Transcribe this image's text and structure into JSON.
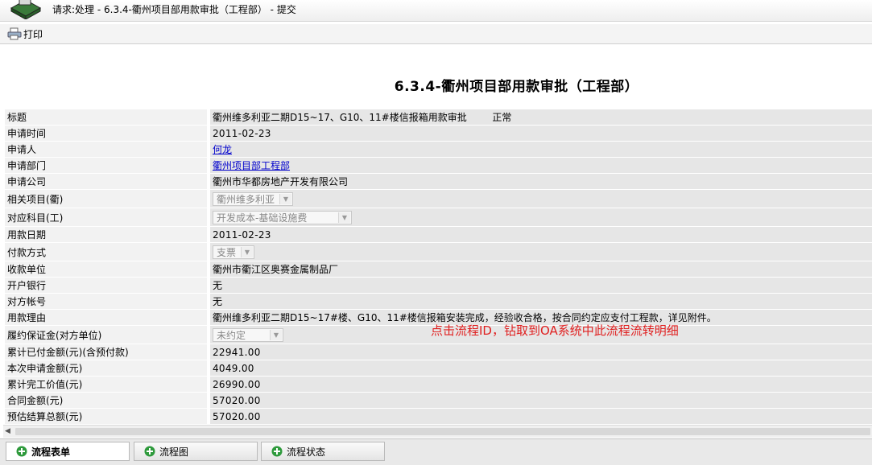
{
  "window": {
    "title": "请求:处理  - 6.3.4-衢州项目部用款审批（工程部） - 提交"
  },
  "toolbar": {
    "print_label": "打印",
    "print_icon": "printer-icon"
  },
  "form": {
    "title": "6.3.4-衢州项目部用款审批（工程部）",
    "rows": {
      "subject": {
        "label": "标题",
        "value": "衢州维多利亚二期D15~17、G10、11#楼信报箱用款审批",
        "priority": "正常"
      },
      "apply_date": {
        "label": "申请时间",
        "value": "2011-02-23"
      },
      "applicant": {
        "label": "申请人",
        "value": "何龙"
      },
      "department": {
        "label": "申请部门",
        "value": "衢州项目部工程部"
      },
      "company": {
        "label": "申请公司",
        "value": "衢州市华都房地产开发有限公司"
      },
      "project": {
        "label": "相关项目(衢)",
        "value": "衢州维多利亚"
      },
      "account": {
        "label": "对应科目(工)",
        "value": "开发成本-基础设施费"
      },
      "use_date": {
        "label": "用款日期",
        "value": "2011-02-23"
      },
      "payment_method": {
        "label": "付款方式",
        "value": "支票"
      },
      "payee": {
        "label": "收款单位",
        "value": "衢州市衢江区奥赛金属制品厂"
      },
      "bank": {
        "label": "开户银行",
        "value": "无"
      },
      "account_no": {
        "label": "对方帐号",
        "value": "无"
      },
      "reason": {
        "label": "用款理由",
        "value": "衢州维多利亚二期D15~17#楼、G10、11#楼信报箱安装完成，经验收合格，按合同约定应支付工程款，详见附件。"
      },
      "deposit": {
        "label": "履约保证金(对方单位)",
        "value": "未约定"
      },
      "paid_total": {
        "label": "累计已付金额(元)(含预付款)",
        "value": "22941.00"
      },
      "current_amount": {
        "label": "本次申请金额(元)",
        "value": "4049.00"
      },
      "completed_value": {
        "label": "累计完工价值(元)",
        "value": "26990.00"
      },
      "contract_amount": {
        "label": "合同金额(元)",
        "value": "57020.00"
      },
      "estimated_total": {
        "label": "预估结算总额(元)",
        "value": "57020.00"
      }
    }
  },
  "annotation": "点击流程ID，钻取到OA系统中此流程流转明细",
  "tabs": [
    {
      "label": "流程表单",
      "active": true,
      "icon": "add-circle-icon"
    },
    {
      "label": "流程图",
      "active": false,
      "icon": "add-circle-icon"
    },
    {
      "label": "流程状态",
      "active": false,
      "icon": "add-circle-icon"
    }
  ],
  "colors": {
    "annotation": "#e02020",
    "link": "#0000cc",
    "tab_icon": "#2e9a3c"
  }
}
